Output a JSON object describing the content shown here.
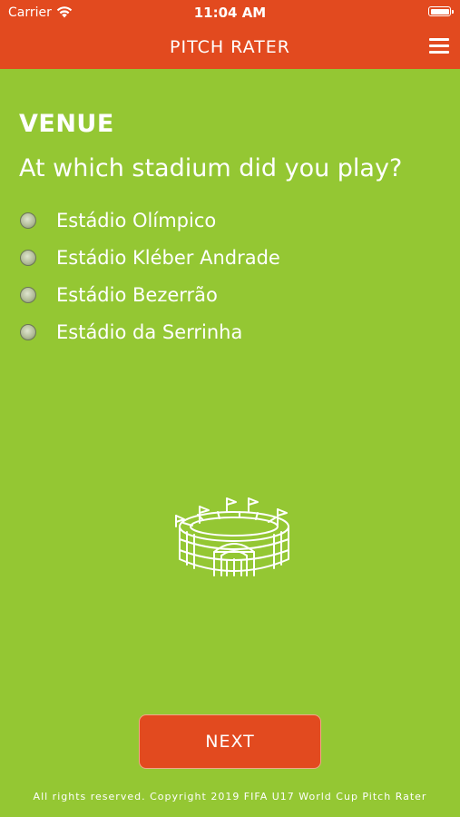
{
  "status_bar": {
    "carrier": "Carrier",
    "time": "11:04 AM"
  },
  "header": {
    "title": "PITCH RATER",
    "menu_icon": "hamburger-menu-icon"
  },
  "section": {
    "title": "VENUE",
    "question": "At which stadium did you play?"
  },
  "options": [
    {
      "label": "Estádio Olímpico",
      "selected": false
    },
    {
      "label": "Estádio Kléber Andrade",
      "selected": false
    },
    {
      "label": "Estádio Bezerrão",
      "selected": false
    },
    {
      "label": "Estádio da Serrinha",
      "selected": false
    }
  ],
  "illustration": "stadium-icon",
  "next_button": {
    "label": "NEXT"
  },
  "footer": {
    "text": "All rights reserved. Copyright 2019 FIFA U17 World Cup Pitch Rater"
  },
  "colors": {
    "header": "#e24a1f",
    "background": "#94c733",
    "button": "#e24a1f",
    "text": "#ffffff"
  }
}
